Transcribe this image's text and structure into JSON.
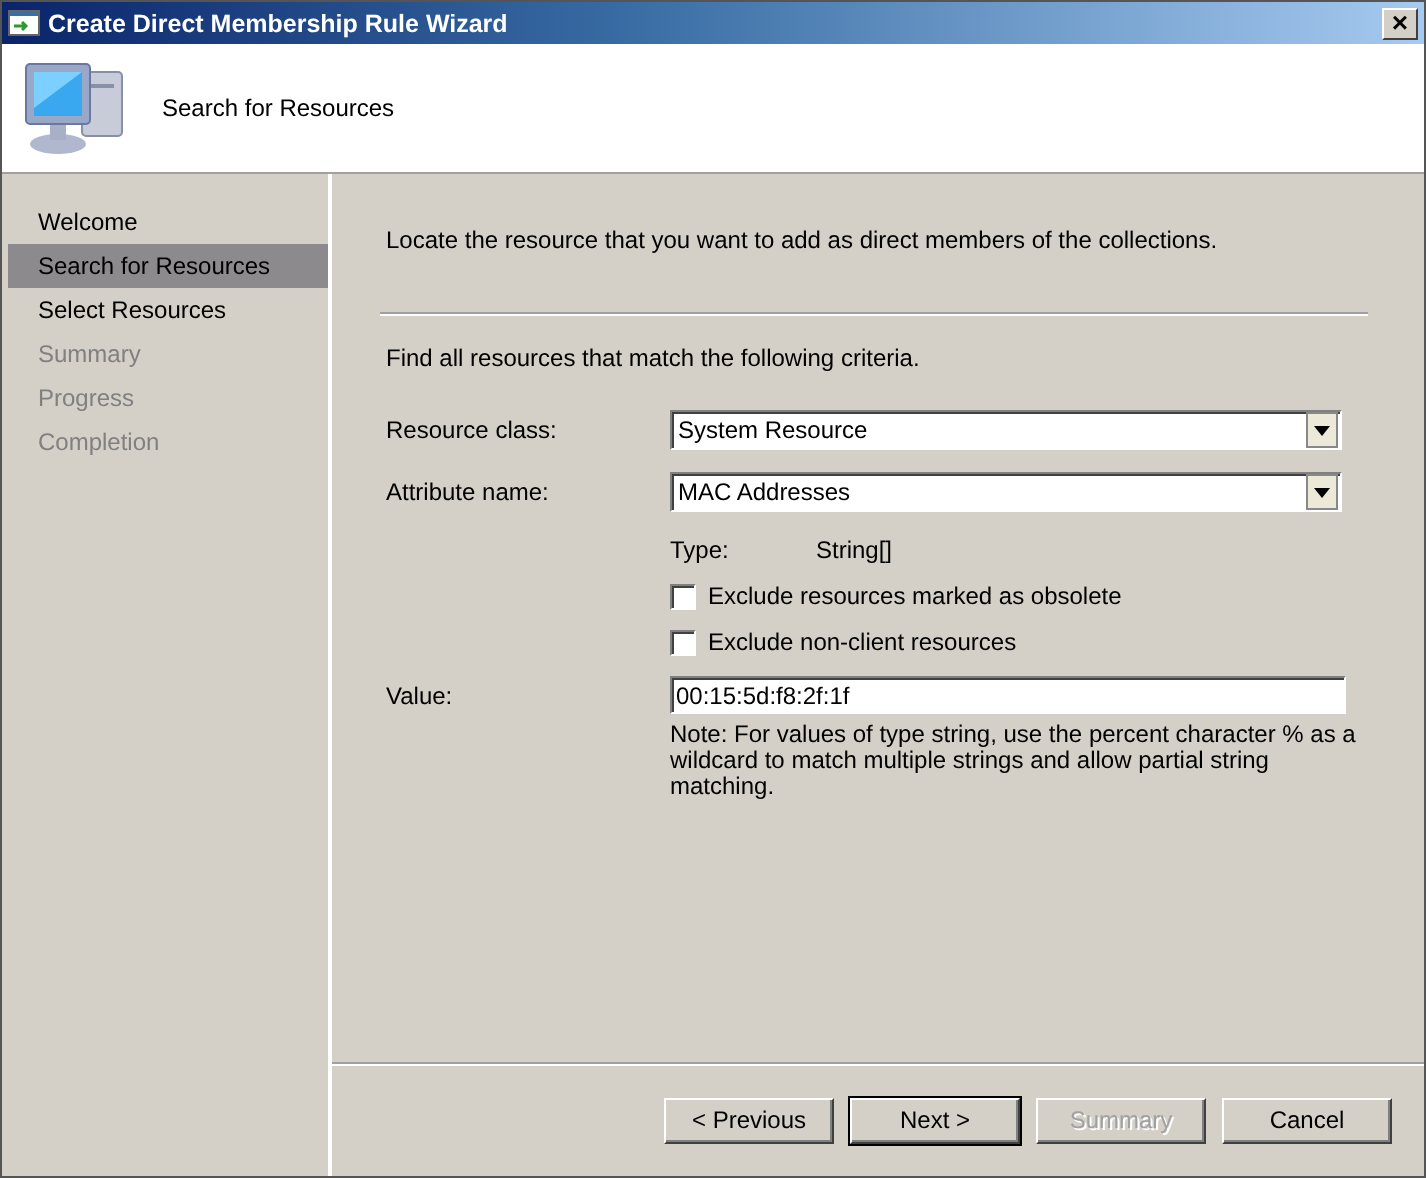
{
  "window": {
    "title": "Create Direct Membership Rule Wizard",
    "close": "×"
  },
  "header": {
    "title": "Search for Resources"
  },
  "steps": [
    {
      "label": "Welcome",
      "selected": false,
      "disabled": false
    },
    {
      "label": "Search for Resources",
      "selected": true,
      "disabled": false
    },
    {
      "label": "Select Resources",
      "selected": false,
      "disabled": false
    },
    {
      "label": "Summary",
      "selected": false,
      "disabled": true
    },
    {
      "label": "Progress",
      "selected": false,
      "disabled": true
    },
    {
      "label": "Completion",
      "selected": false,
      "disabled": true
    }
  ],
  "intro": "Locate the resource that you want to add as direct members of the collections.",
  "criteria_heading": "Find all resources that match the following criteria.",
  "resource_class": {
    "label": "Resource class:",
    "value": "System Resource"
  },
  "attribute_name": {
    "label": "Attribute name:",
    "value": "MAC Addresses"
  },
  "type": {
    "label": "Type:",
    "value": "String[]"
  },
  "options": [
    {
      "label": "Exclude resources marked as obsolete",
      "checked": false
    },
    {
      "label": "Exclude non-client resources",
      "checked": false
    }
  ],
  "value": {
    "label": "Value:",
    "value": "00:15:5d:f8:2f:1f"
  },
  "note": "Note: For values of type string, use the percent character % as a wildcard to match multiple strings and allow partial string matching.",
  "buttons": [
    {
      "label": "< Previous",
      "disabled": false,
      "default": false
    },
    {
      "label": "Next >",
      "disabled": false,
      "default": true
    },
    {
      "label": "Summary",
      "disabled": true,
      "default": false
    },
    {
      "label": "Cancel",
      "disabled": false,
      "default": false
    }
  ]
}
